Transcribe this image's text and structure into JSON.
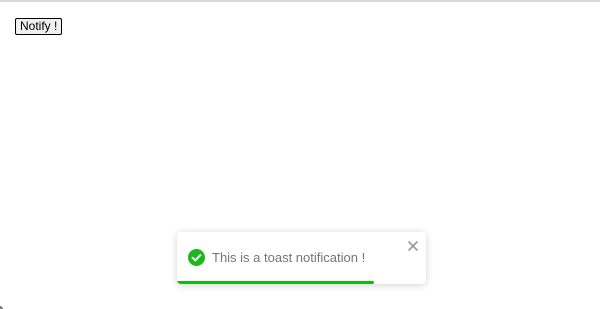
{
  "page": {
    "notify_button_label": "Notify !"
  },
  "toast": {
    "message": "This is a toast notification !",
    "type": "success",
    "icon": "check-circle-icon",
    "close_icon": "close-icon",
    "progress_fraction": 0.79,
    "colors": {
      "success": "#1db81d",
      "progress": "#14b814",
      "text": "#757575",
      "close": "#9a9a9a"
    }
  }
}
